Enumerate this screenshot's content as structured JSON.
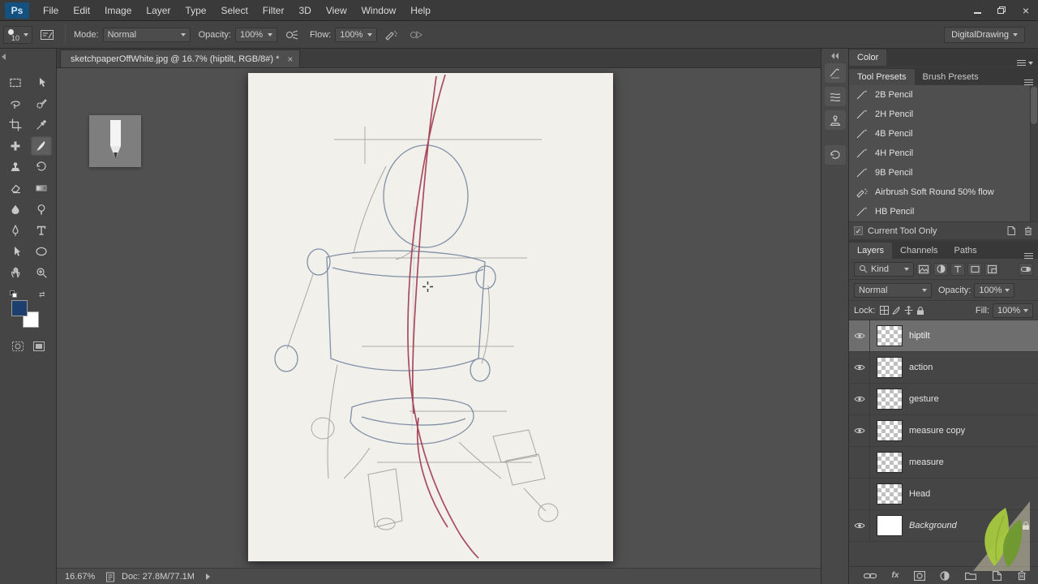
{
  "menubar": {
    "logo": "Ps",
    "items": [
      "File",
      "Edit",
      "Image",
      "Layer",
      "Type",
      "Select",
      "Filter",
      "3D",
      "View",
      "Window",
      "Help"
    ]
  },
  "options": {
    "brush_size": "10",
    "mode_label": "Mode:",
    "mode_value": "Normal",
    "opacity_label": "Opacity:",
    "opacity_value": "100%",
    "flow_label": "Flow:",
    "flow_value": "100%",
    "workspace": "DigitalDrawing"
  },
  "document": {
    "tab_title": "sketchpaperOffWhite.jpg @ 16.7% (hiptilt, RGB/8#) *"
  },
  "tools": [
    "rectangular-marquee",
    "move",
    "lasso",
    "quick-selection",
    "crop",
    "eyedropper",
    "healing-brush",
    "brush",
    "clone-stamp",
    "history-brush",
    "eraser",
    "gradient",
    "blur",
    "dodge",
    "pen",
    "type",
    "path-selection",
    "ellipse-shape",
    "hand",
    "zoom"
  ],
  "color_panel": {
    "title": "Color"
  },
  "presets_panel": {
    "tabs": [
      "Tool Presets",
      "Brush Presets"
    ],
    "items": [
      "2B Pencil",
      "2H Pencil",
      "4B Pencil",
      "4H Pencil",
      "9B Pencil",
      "Airbrush Soft Round 50% flow",
      "HB Pencil"
    ],
    "current_tool_only_label": "Current Tool Only"
  },
  "layers_panel": {
    "tabs": [
      "Layers",
      "Channels",
      "Paths"
    ],
    "kind_value": "Kind",
    "blend_mode": "Normal",
    "opacity_label": "Opacity:",
    "opacity_value": "100%",
    "lock_label": "Lock:",
    "fill_label": "Fill:",
    "fill_value": "100%",
    "fx_label": "fx",
    "layers": [
      {
        "name": "hiptilt",
        "visible": true,
        "selected": true
      },
      {
        "name": "action",
        "visible": true,
        "selected": false
      },
      {
        "name": "gesture",
        "visible": true,
        "selected": false
      },
      {
        "name": "measure copy",
        "visible": true,
        "selected": false
      },
      {
        "name": "measure",
        "visible": false,
        "selected": false
      },
      {
        "name": "Head",
        "visible": false,
        "selected": false
      },
      {
        "name": "Background",
        "visible": true,
        "selected": false,
        "locked": true
      }
    ]
  },
  "status": {
    "zoom": "16.67%",
    "doc_label": "Doc: 27.8M/77.1M"
  },
  "colors": {
    "foreground_swatch": "#1c3f6e",
    "background_swatch": "#ffffff",
    "sketch_red": "#a23a50",
    "sketch_blue": "#76859f",
    "sketch_gray": "#979797",
    "paper": "#f1f0ea"
  }
}
